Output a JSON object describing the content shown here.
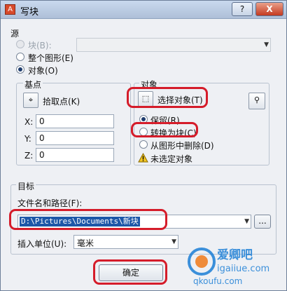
{
  "window": {
    "title": "写块",
    "help_label": "?",
    "close_label": "X"
  },
  "source": {
    "heading": "源",
    "block_label": "块(B):",
    "whole_label": "整个图形(E)",
    "objects_label": "对象(O)",
    "selected": "objects_label"
  },
  "basepoint": {
    "heading": "基点",
    "pick_label": "拾取点(K)",
    "x_label": "X:",
    "x_value": "0",
    "y_label": "Y:",
    "y_value": "0",
    "z_label": "Z:",
    "z_value": "0"
  },
  "objects": {
    "heading": "对象",
    "select_label": "选择对象(T)",
    "retain_label": "保留(R)",
    "convert_label": "转换为块(C)",
    "delete_label": "从图形中删除(D)",
    "status_text": "未选定对象",
    "selected": "retain_label"
  },
  "destination": {
    "heading": "目标",
    "filename_label": "文件名和路径(F):",
    "filename_value": "D:\\Pictures\\Documents\\新块",
    "browse_label": "...",
    "units_label": "插入单位(U):",
    "units_value": "毫米"
  },
  "footer": {
    "ok_label": "确定"
  },
  "watermark": {
    "brand": "爱卿吧",
    "url": "igaiiue.com",
    "url2": "qkoufu.com"
  },
  "colors": {
    "highlight": "#d51c2a",
    "selection": "#1d57a8"
  }
}
